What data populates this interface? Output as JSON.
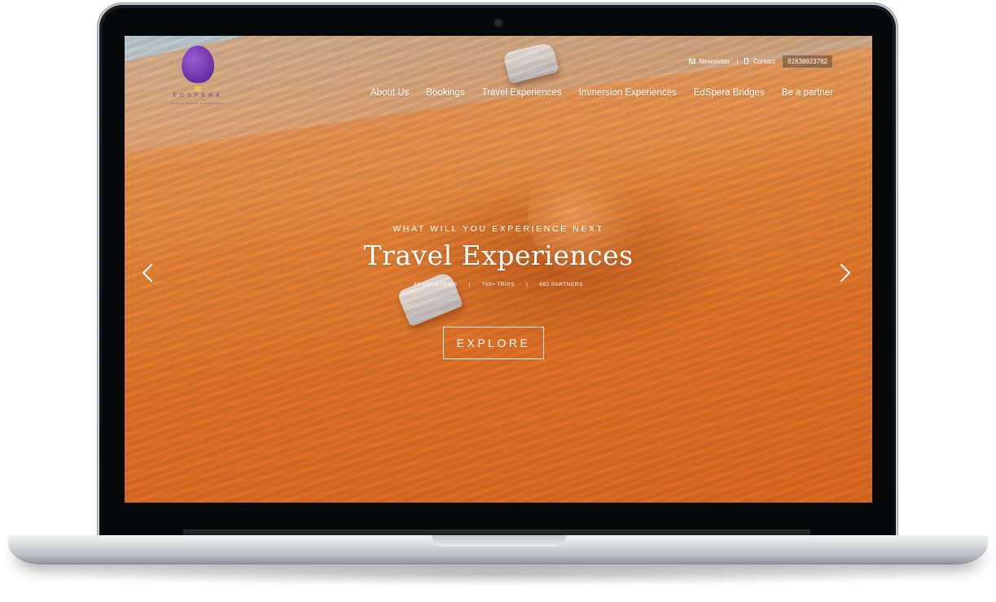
{
  "brand": {
    "name": "EDSPERA",
    "tagline": "ADVENTUROUS WONDERINGS"
  },
  "utility": {
    "newsletter": "Newsletter",
    "separator": "|",
    "contact": "Contact",
    "phone": "92838923782"
  },
  "nav": {
    "items": [
      "About Us",
      "Bookings",
      "Travel Experiences",
      "Immersion Experiences",
      "EdSpera Bridges",
      "Be a partner"
    ]
  },
  "hero": {
    "eyebrow": "WHAT WILL YOU EXPERIENCE NEXT",
    "title": "Travel Experiences",
    "stats": [
      "42 COUNTRIES",
      "|",
      "700+ TRIPS",
      "|",
      "682 PARTNERS"
    ],
    "cta": "EXPLORE"
  },
  "colors": {
    "sand": "#e1782a",
    "logo_purple": "#6a2ea4",
    "text": "#ffffff"
  },
  "icons": {
    "newsletter": "envelope-icon",
    "contact": "mobile-phone-icon",
    "prev": "chevron-left-icon",
    "next": "chevron-right-icon"
  }
}
